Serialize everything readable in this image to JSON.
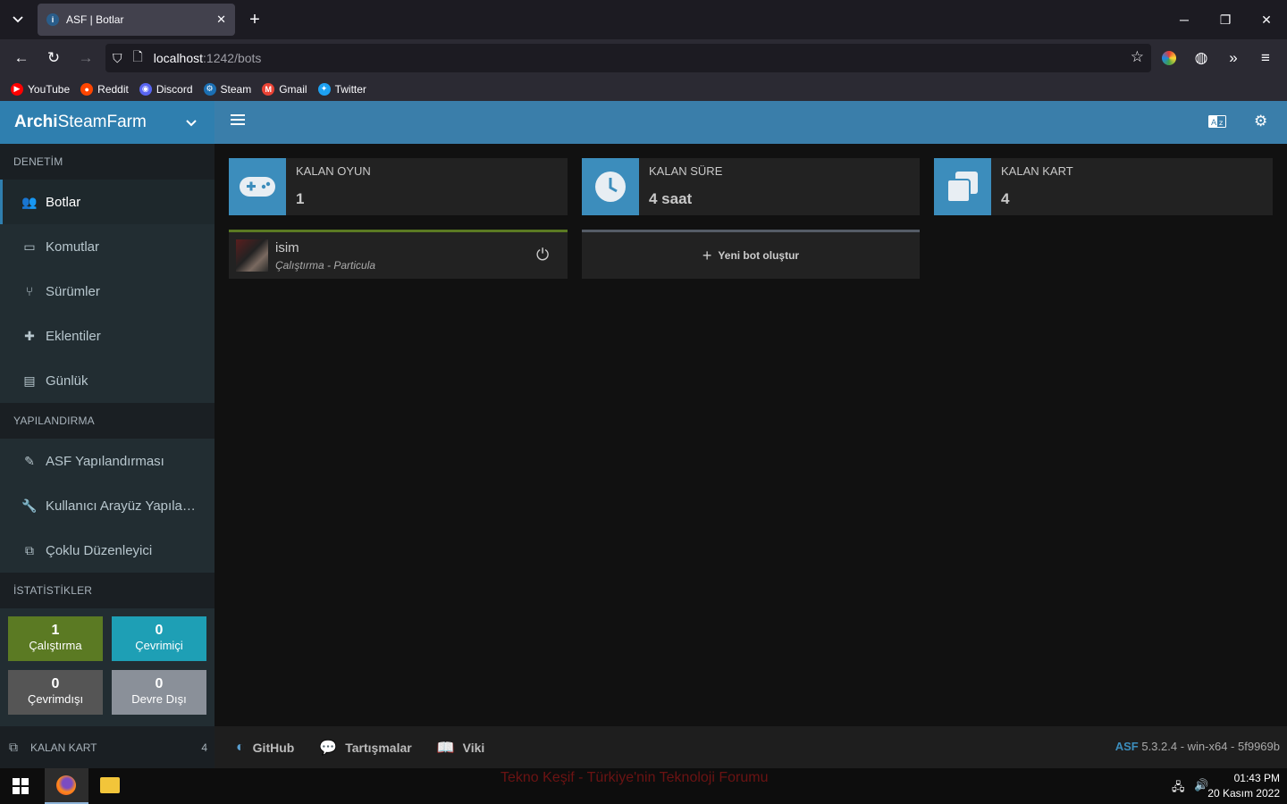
{
  "browser": {
    "tab_title": "ASF | Botlar",
    "url_host": "localhost",
    "url_path": ":1242/bots",
    "bookmarks": [
      {
        "label": "YouTube",
        "color": "#ff0000"
      },
      {
        "label": "Reddit",
        "color": "#ff4500"
      },
      {
        "label": "Discord",
        "color": "#5865f2"
      },
      {
        "label": "Steam",
        "color": "#1b6fb3"
      },
      {
        "label": "Gmail",
        "color": "#ea4335"
      },
      {
        "label": "Twitter",
        "color": "#1da1f2"
      }
    ]
  },
  "brand": {
    "bold": "Archi",
    "rest": "SteamFarm"
  },
  "sidebar": {
    "section_control": "DENETİM",
    "control_items": [
      {
        "label": "Botlar",
        "icon": "users-icon",
        "active": true
      },
      {
        "label": "Komutlar",
        "icon": "laptop-icon"
      },
      {
        "label": "Sürümler",
        "icon": "code-branch-icon"
      },
      {
        "label": "Eklentiler",
        "icon": "puzzle-icon"
      },
      {
        "label": "Günlük",
        "icon": "file-icon"
      }
    ],
    "section_config": "YAPILANDIRMA",
    "config_items": [
      {
        "label": "ASF Yapılandırması",
        "icon": "edit-icon"
      },
      {
        "label": "Kullanıcı Arayüz Yapılandırması",
        "icon": "wrench-icon"
      },
      {
        "label": "Çoklu Düzenleyici",
        "icon": "copy-icon"
      }
    ],
    "section_stats": "İSTATİSTİKLER",
    "stats": [
      {
        "count": "1",
        "label": "Çalıştırma",
        "color": "#5b7a23"
      },
      {
        "count": "0",
        "label": "Çevrimiçi",
        "color": "#1e9fb5"
      },
      {
        "count": "0",
        "label": "Çevrimdışı",
        "color": "#555"
      },
      {
        "count": "0",
        "label": "Devre Dışı",
        "color": "#8a9099"
      }
    ],
    "footer_label": "KALAN KART",
    "footer_count": "4"
  },
  "infoboxes": [
    {
      "title": "KALAN OYUN",
      "value": "1",
      "icon": "gamepad-icon"
    },
    {
      "title": "KALAN SÜRE",
      "value": "4 saat",
      "icon": "clock-icon"
    },
    {
      "title": "KALAN KART",
      "value": "4",
      "icon": "clone-icon"
    }
  ],
  "bot": {
    "name": "isim",
    "status": "Çalıştırma",
    "game": "Particula"
  },
  "new_bot_label": "Yeni bot oluştur",
  "footer": {
    "links": [
      {
        "label": "GitHub",
        "icon": "github-icon"
      },
      {
        "label": "Tartışmalar",
        "icon": "comments-icon"
      },
      {
        "label": "Viki",
        "icon": "book-icon"
      }
    ],
    "version_brand": "ASF",
    "version_text": "5.3.2.4 - win-x64 - 5f9969b"
  },
  "taskbar": {
    "watermark": "Tekno Keşif - Türkiye'nin Teknoloji Forumu",
    "time": "01:43 PM",
    "date": "20 Kasım 2022"
  }
}
